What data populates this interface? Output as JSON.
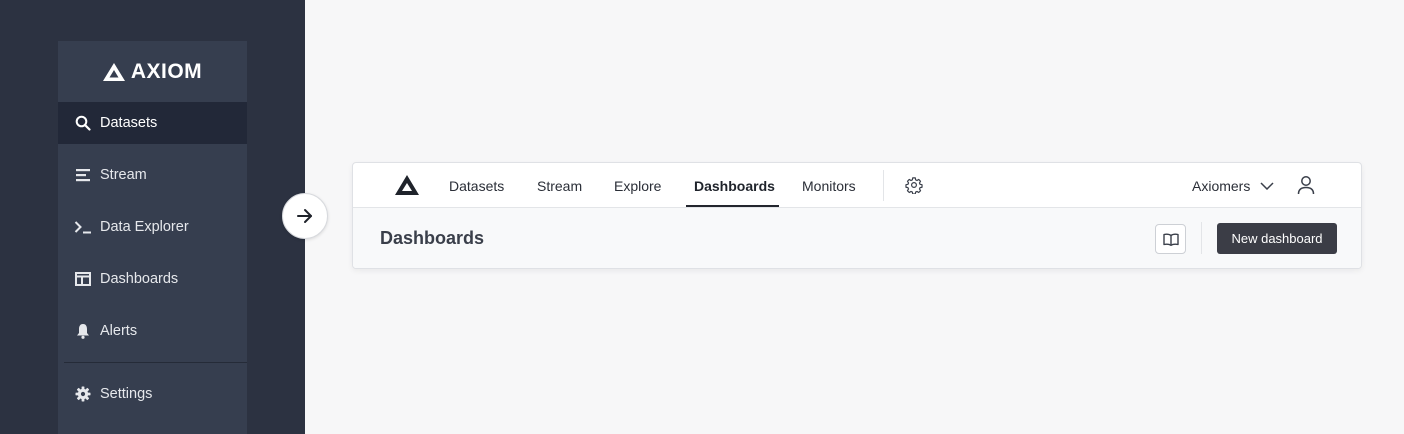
{
  "legacy_sidebar": {
    "brand": "AXIOM",
    "items": [
      {
        "label": "Datasets",
        "icon": "search-icon",
        "active": true
      },
      {
        "label": "Stream",
        "icon": "stream-lines-icon"
      },
      {
        "label": "Data Explorer",
        "icon": "terminal-prompt-icon"
      },
      {
        "label": "Dashboards",
        "icon": "dashboard-panel-icon"
      },
      {
        "label": "Alerts",
        "icon": "bell-icon"
      },
      {
        "label": "Settings",
        "icon": "gear-icon"
      }
    ]
  },
  "transition_arrow_icon": "arrow-right-icon",
  "new_ui": {
    "nav": {
      "logo_icon": "axiom-logo-icon",
      "tabs": [
        {
          "label": "Datasets"
        },
        {
          "label": "Stream"
        },
        {
          "label": "Explore"
        },
        {
          "label": "Dashboards",
          "active": true
        },
        {
          "label": "Monitors"
        }
      ],
      "settings_icon": "gear-icon",
      "org_name": "Axiomers",
      "org_chevron_icon": "chevron-down-icon",
      "user_icon": "user-icon"
    },
    "subheader": {
      "title": "Dashboards",
      "docs_icon": "book-open-icon",
      "new_button_label": "New dashboard"
    }
  },
  "colors": {
    "sidebar_bg": "#2c3241",
    "sidebar_panel": "#363e4f",
    "sidebar_active": "#222838",
    "primary_button": "#3b3d46",
    "page_bg": "#f7f7f8"
  }
}
